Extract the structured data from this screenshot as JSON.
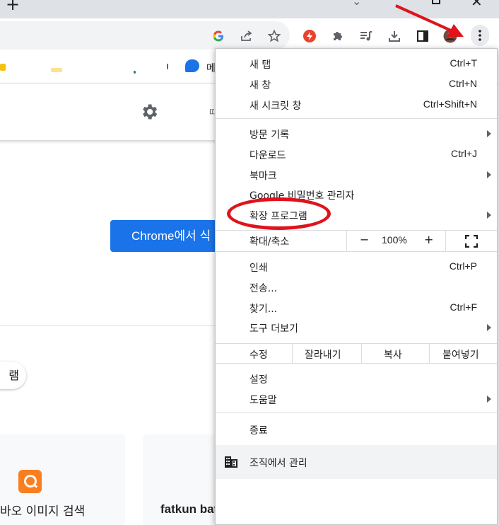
{
  "colors": {
    "accent": "#1a73e8",
    "annotation_red": "#e0131b",
    "bookmark_bar_msg": "#1a73e8"
  },
  "titlebar": {
    "new_tab_icon": "plus-icon",
    "close_glyph": "✕"
  },
  "toolbar": {
    "icons": [
      "google-g-icon",
      "share-icon",
      "bookmark-star-icon",
      "extension-red-icon",
      "puzzle-icon",
      "media-queue-icon",
      "download-icon",
      "side-panel-icon",
      "profile-avatar",
      "more-menu-icon"
    ]
  },
  "bookmarks": {
    "last_label": "메"
  },
  "page": {
    "hidden_text": "따",
    "cta_label": "Chrome에서 식",
    "pill_label": "램",
    "cards": [
      {
        "title": "바오 이미지 검색"
      },
      {
        "title": "fatkun batch download ..."
      }
    ]
  },
  "menu": {
    "group1": [
      {
        "label": "새 탭",
        "shortcut": "Ctrl+T"
      },
      {
        "label": "새 창",
        "shortcut": "Ctrl+N"
      },
      {
        "label": "새 시크릿 창",
        "shortcut": "Ctrl+Shift+N"
      }
    ],
    "group2": [
      {
        "label": "방문 기록",
        "shortcut": "",
        "submenu": true
      },
      {
        "label": "다운로드",
        "shortcut": "Ctrl+J",
        "submenu": false
      },
      {
        "label": "북마크",
        "shortcut": "",
        "submenu": true
      },
      {
        "label": "Google 비밀번호 관리자",
        "shortcut": "",
        "submenu": false
      },
      {
        "label": "확장 프로그램",
        "shortcut": "",
        "submenu": true
      }
    ],
    "zoom": {
      "label": "확대/축소",
      "minus": "−",
      "value": "100%",
      "plus": "+"
    },
    "group3": [
      {
        "label": "인쇄",
        "shortcut": "Ctrl+P"
      },
      {
        "label": "전송...",
        "shortcut": ""
      },
      {
        "label": "찾기...",
        "shortcut": "Ctrl+F"
      },
      {
        "label": "도구 더보기",
        "shortcut": "",
        "submenu": true
      }
    ],
    "edit": {
      "label": "수정",
      "cut": "잘라내기",
      "copy": "복사",
      "paste": "붙여넣기"
    },
    "group4": [
      {
        "label": "설정"
      },
      {
        "label": "도움말",
        "submenu": true
      }
    ],
    "exit": "종료",
    "managed": {
      "label": "조직에서 관리",
      "icon": "building-icon"
    }
  }
}
